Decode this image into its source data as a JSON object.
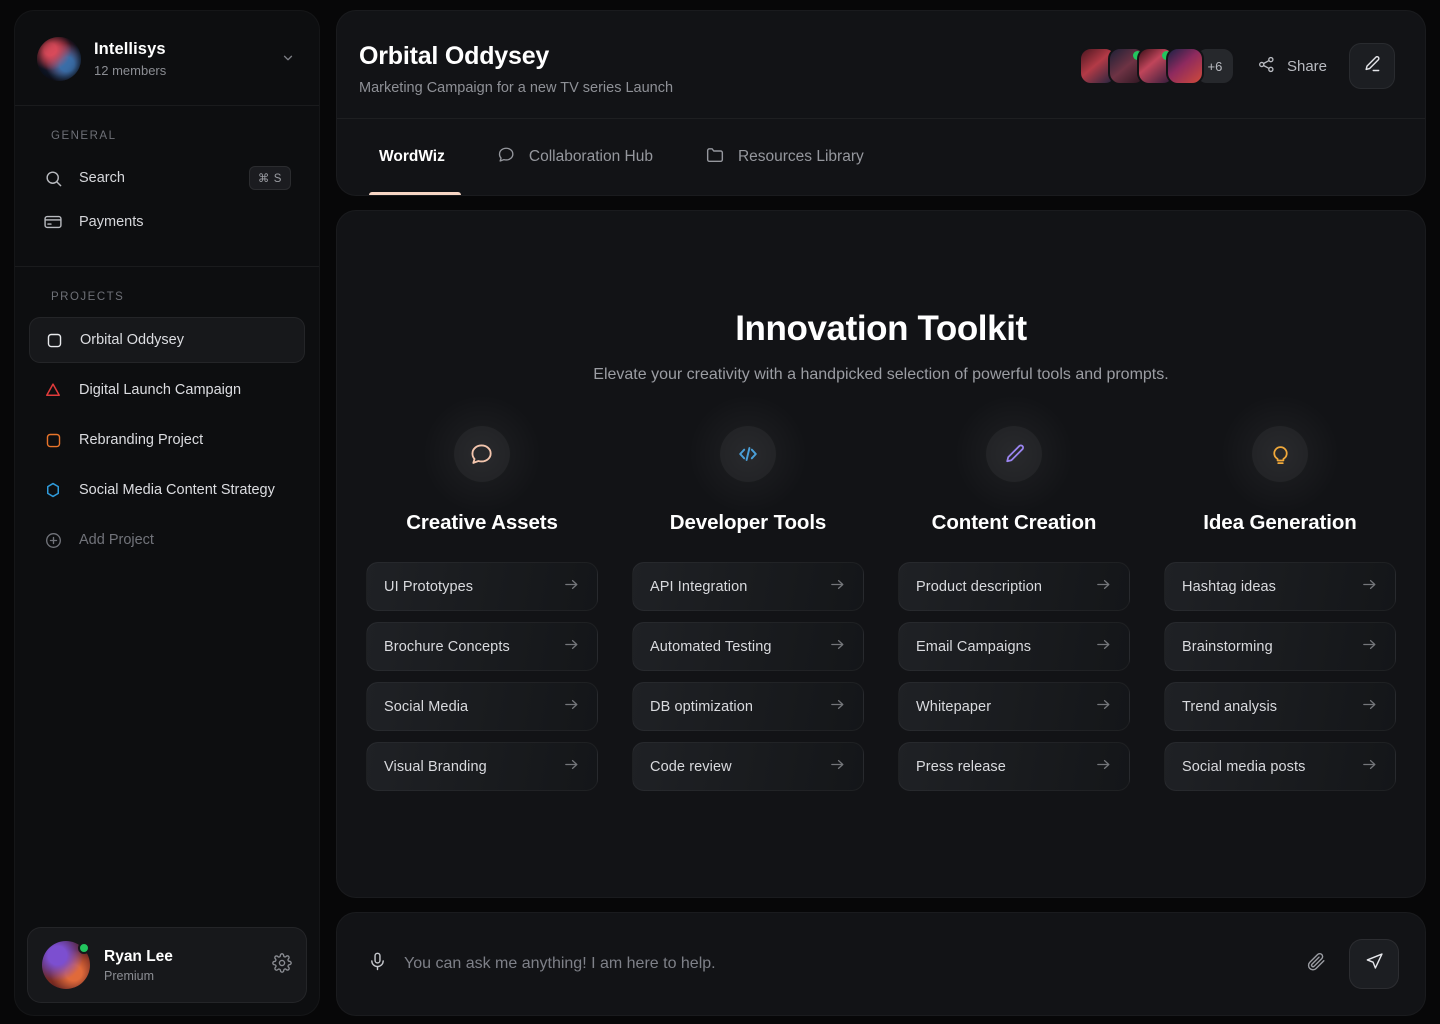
{
  "sidebar": {
    "org": {
      "name": "Intellisys",
      "members": "12 members",
      "chevron_icon": "chevron-down-icon"
    },
    "general": {
      "label": "GENERAL",
      "items": [
        {
          "label": "Search",
          "icon": "search-icon",
          "shortcut": "⌘ S"
        },
        {
          "label": "Payments",
          "icon": "credit-card-icon",
          "shortcut": ""
        }
      ]
    },
    "projects": {
      "label": "PROJECTS",
      "items": [
        {
          "label": "Orbital Oddysey",
          "icon": "square-icon",
          "color": "#e8e9ec",
          "active": true
        },
        {
          "label": "Digital Launch Campaign",
          "icon": "triangle-icon",
          "color": "#e03b3b",
          "active": false
        },
        {
          "label": "Rebranding Project",
          "icon": "square-icon",
          "color": "#e8742a",
          "active": false
        },
        {
          "label": "Social Media Content Strategy",
          "icon": "hexagon-icon",
          "color": "#2f9bdb",
          "active": false
        }
      ],
      "add": {
        "label": "Add Project",
        "icon": "plus-circle-icon"
      }
    },
    "user": {
      "name": "Ryan Lee",
      "plan": "Premium",
      "status": "online",
      "settings_icon": "gear-icon"
    }
  },
  "header": {
    "title": "Orbital Oddysey",
    "subtitle": "Marketing Campaign for a new TV series Launch",
    "avatars_overflow": "+6",
    "share_label": "Share",
    "share_icon": "share-nodes-icon",
    "edit_icon": "pencil-icon"
  },
  "tabs": [
    {
      "label": "WordWiz",
      "icon": "",
      "active": true
    },
    {
      "label": "Collaboration Hub",
      "icon": "chat-bubble-icon",
      "active": false
    },
    {
      "label": "Resources Library",
      "icon": "folder-icon",
      "active": false
    }
  ],
  "hero": {
    "title": "Innovation Toolkit",
    "subtitle": "Elevate your creativity with a handpicked selection of powerful tools and prompts."
  },
  "categories": [
    {
      "title": "Creative Assets",
      "icon": "chat-bubble-icon",
      "icon_color": "#f3c5ad",
      "prompts": [
        "UI Prototypes",
        "Brochure Concepts",
        "Social Media",
        "Visual Branding"
      ]
    },
    {
      "title": "Developer Tools",
      "icon": "code-icon",
      "icon_color": "#4a9fd8",
      "prompts": [
        "API Integration",
        "Automated Testing",
        "DB optimization",
        "Code review"
      ]
    },
    {
      "title": "Content Creation",
      "icon": "pencil-icon",
      "icon_color": "#9b85f0",
      "prompts": [
        "Product description",
        "Email Campaigns",
        "Whitepaper",
        "Press release"
      ]
    },
    {
      "title": "Idea Generation",
      "icon": "lightbulb-icon",
      "icon_color": "#f0a83a",
      "prompts": [
        "Hashtag ideas",
        "Brainstorming",
        "Trend analysis",
        "Social media posts"
      ]
    }
  ],
  "composer": {
    "placeholder": "You can ask me anything! I am here to help.",
    "value": "",
    "mic_icon": "microphone-icon",
    "attach_icon": "paperclip-icon",
    "send_icon": "send-icon"
  },
  "theme": {
    "page_bg": "#070708",
    "sidebar_bg": "#0d0e10",
    "panel_bg": "#121316",
    "accent": "#f7d6c4",
    "online": "#22c55e"
  }
}
